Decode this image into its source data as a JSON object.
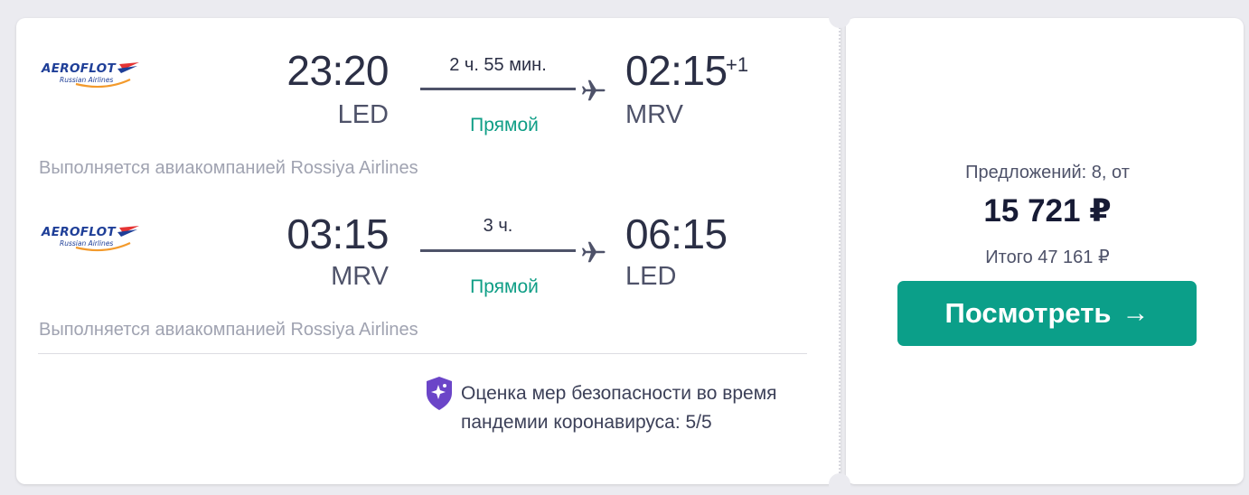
{
  "colors": {
    "accent": "#0b9f89",
    "direct_label": "#0f9e86",
    "safety_icon": "#6b45c8"
  },
  "flights": [
    {
      "airline_logo": {
        "wordmark": "AEROFLOT",
        "subtitle": "Russian Airlines",
        "icon": "aeroflot-logo"
      },
      "departure": {
        "time": "23:20",
        "airport": "LED"
      },
      "arrival": {
        "time": "02:15",
        "day_offset": "+1",
        "airport": "MRV"
      },
      "duration": "2 ч. 55 мин.",
      "stops": "Прямой",
      "operated_by": "Выполняется авиакомпанией Rossiya Airlines"
    },
    {
      "airline_logo": {
        "wordmark": "AEROFLOT",
        "subtitle": "Russian Airlines",
        "icon": "aeroflot-logo"
      },
      "departure": {
        "time": "03:15",
        "airport": "MRV"
      },
      "arrival": {
        "time": "06:15",
        "airport": "LED"
      },
      "duration": "3 ч.",
      "stops": "Прямой",
      "operated_by": "Выполняется авиакомпанией Rossiya Airlines"
    }
  ],
  "safety": {
    "icon": "shield-sparkle-icon",
    "text": "Оценка мер безопасности во время пандемии коронавируса: 5/5"
  },
  "pricing": {
    "offers": "Предложений: 8, от",
    "price": "15 721 ₽",
    "total": "Итого 47 161 ₽",
    "button_label": "Посмотреть",
    "button_icon": "arrow-right-icon"
  }
}
